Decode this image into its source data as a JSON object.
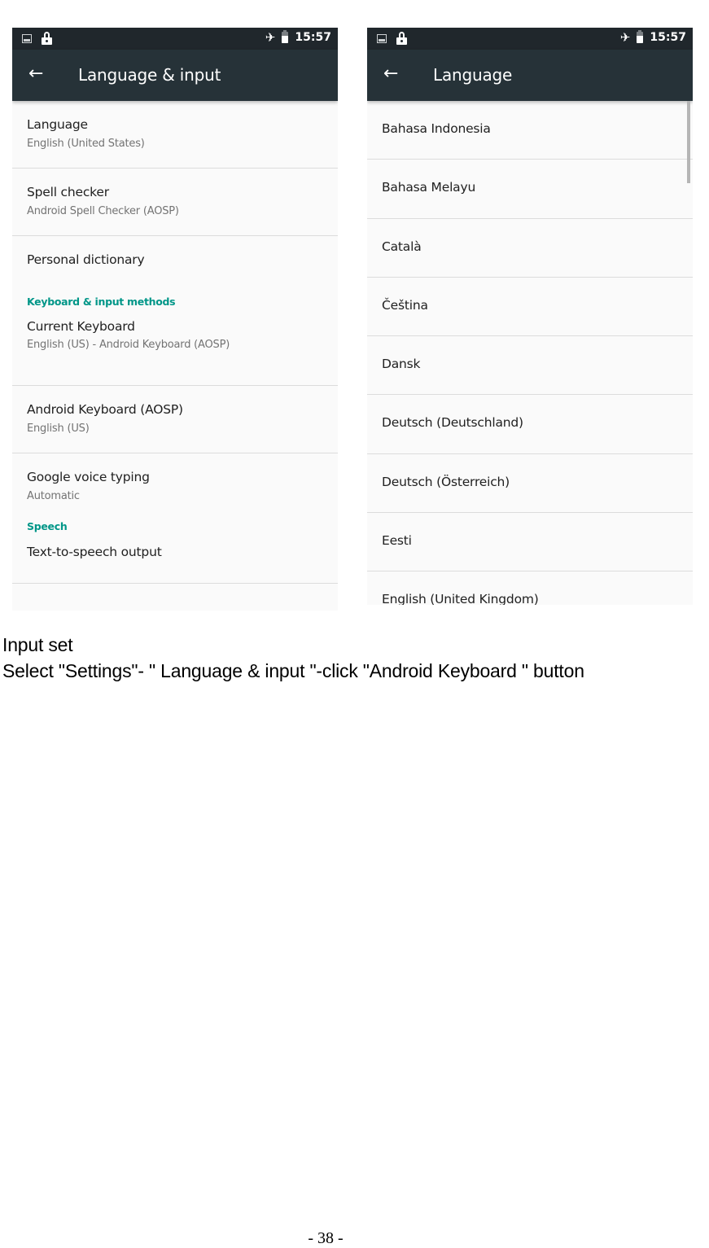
{
  "status_bar": {
    "time": "15:57",
    "left_icons": [
      "image-notification-icon",
      "lock-icon"
    ],
    "right_icons": [
      "airplane-mode-icon",
      "battery-icon"
    ]
  },
  "left_screen": {
    "title": "Language & input",
    "back_icon": "←",
    "items": [
      {
        "type": "pref",
        "title": "Language",
        "summary": "English (United States)"
      },
      {
        "type": "pref",
        "title": "Spell checker",
        "summary": "Android Spell Checker (AOSP)"
      },
      {
        "type": "pref",
        "title": "Personal dictionary"
      },
      {
        "type": "category",
        "title": "Keyboard & input methods"
      },
      {
        "type": "pref",
        "title": "Current Keyboard",
        "summary": "English (US) - Android Keyboard (AOSP)"
      },
      {
        "type": "pref",
        "title": "Android Keyboard (AOSP)",
        "summary": "English (US)"
      },
      {
        "type": "pref",
        "title": "Google voice typing",
        "summary": "Automatic"
      },
      {
        "type": "category",
        "title": "Speech"
      },
      {
        "type": "pref",
        "title": "Text-to-speech output"
      }
    ]
  },
  "right_screen": {
    "title": "Language",
    "back_icon": "←",
    "languages": [
      "Bahasa Indonesia",
      "Bahasa Melayu",
      "Català",
      "Čeština",
      "Dansk",
      "Deutsch (Deutschland)",
      "Deutsch (Österreich)",
      "Eesti",
      "English (United Kingdom)"
    ]
  },
  "document": {
    "heading": "Input set",
    "instruction": "Select \"Settings\"- \" Language & input \"-click \"Android Keyboard \" button",
    "page_number": "- 38 -"
  },
  "colors": {
    "status_bar": "#20272c",
    "app_bar": "#263238",
    "accent": "#009688",
    "background": "#fafafa"
  }
}
